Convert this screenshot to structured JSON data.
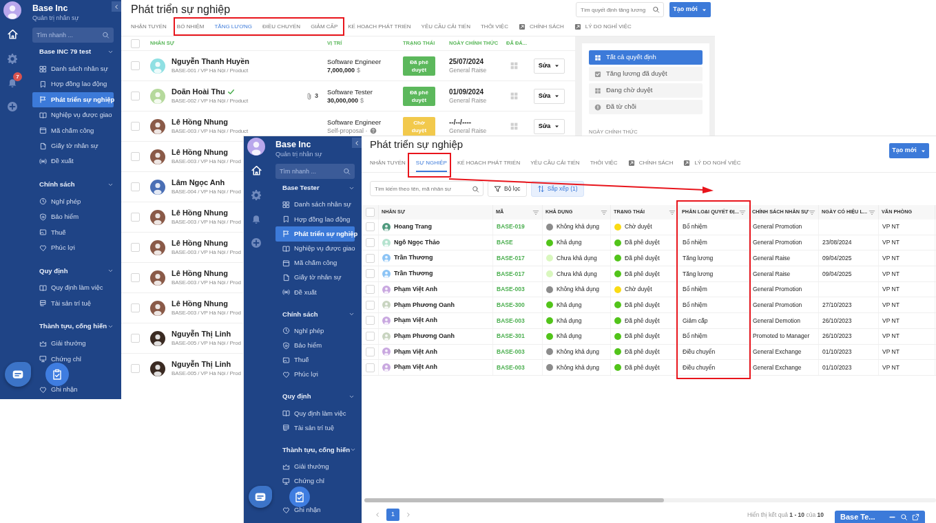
{
  "back_screen": {
    "sidebar": {
      "brand": "Base Inc",
      "subtitle": "Quản trị nhân sự",
      "search": {
        "placeholder": "Tìm nhanh ..."
      },
      "notification_count": "7",
      "groups": [
        {
          "title": "Base INC 79 test",
          "expanded": true,
          "items": [
            {
              "label": "Danh sách nhân sự",
              "selected": false
            },
            {
              "label": "Hợp đồng lao động",
              "selected": false
            },
            {
              "label": "Phát triển sự nghiệp",
              "selected": true
            },
            {
              "label": "Nghiệp vụ được giao",
              "selected": false
            },
            {
              "label": "Mã chấm công",
              "selected": false
            },
            {
              "label": "Giấy tờ nhân sự",
              "selected": false
            },
            {
              "label": "Đề xuất",
              "selected": false
            }
          ]
        },
        {
          "title": "Chính sách",
          "expanded": true,
          "items": [
            {
              "label": "Nghỉ phép",
              "selected": false
            },
            {
              "label": "Bảo hiểm",
              "selected": false
            },
            {
              "label": "Thuế",
              "selected": false
            },
            {
              "label": "Phúc lợi",
              "selected": false
            }
          ]
        },
        {
          "title": "Quy định",
          "expanded": true,
          "items": [
            {
              "label": "Quy định làm việc",
              "selected": false
            },
            {
              "label": "Tài sản trí tuệ",
              "selected": false
            }
          ]
        },
        {
          "title": "Thành tựu, cống hiến",
          "expanded": true,
          "items": [
            {
              "label": "Giải thưởng",
              "selected": false
            },
            {
              "label": "Chứng chỉ",
              "selected": false
            },
            {
              "label": "Ghi nhận",
              "selected": false
            }
          ]
        }
      ]
    },
    "title": "Phát triển sự nghiệp",
    "search": {
      "placeholder": "Tìm quyết định tăng lương"
    },
    "create_button": "Tạo mới",
    "tabs": [
      {
        "label": "NHẬN TUYỂN",
        "selected": false,
        "kind": "page"
      },
      {
        "label": "BỔ NHIỆM",
        "selected": false,
        "kind": "page"
      },
      {
        "label": "TĂNG LƯƠNG",
        "selected": true,
        "kind": "page"
      },
      {
        "label": "ĐIỀU CHUYỂN",
        "selected": false,
        "kind": "page"
      },
      {
        "label": "GIẢM CẤP",
        "selected": false,
        "kind": "page"
      },
      {
        "label": "KẾ HOẠCH PHÁT TRIỂN",
        "selected": false,
        "kind": "page"
      },
      {
        "label": "YÊU CẦU CẢI TIẾN",
        "selected": false,
        "kind": "page"
      },
      {
        "label": "THÔI VIỆC",
        "selected": false,
        "kind": "page"
      },
      {
        "label": "CHÍNH SÁCH",
        "selected": false,
        "kind": "link"
      },
      {
        "label": "LÝ DO NGHỈ VIỆC",
        "selected": false,
        "kind": "link"
      }
    ],
    "table": {
      "all_checked": false,
      "columns": [
        "NHÂN SỰ",
        "VỊ TRÍ",
        "TRẠNG THÁI",
        "NGÀY CHÍNH THỨC",
        "ĐÃ ĐÁ..."
      ],
      "rows": [
        {
          "checked": false,
          "color": "#8fe0e3",
          "name": "Nguyễn Thanh Huyền",
          "sub": "BASE-001 / VP Hà Nội / Product",
          "position": "Software Engineer",
          "salary": "7,000,000",
          "currency": "$",
          "status": {
            "label": "Đã phê duyệt",
            "color": "#5cb85c"
          },
          "date": "25/07/2024",
          "date_note": "General Raise",
          "action": "Sửa"
        },
        {
          "checked": false,
          "color": "#b5d99c",
          "name": "Doãn Hoài Thu",
          "verified": true,
          "attachments": "3",
          "sub": "BASE-002 / VP Hà Nội / Product",
          "position": "Software Tester",
          "salary": "30,000,000",
          "currency": "$",
          "status": {
            "label": "Đã phê duyệt",
            "color": "#5cb85c"
          },
          "date": "01/09/2024",
          "date_note": "General Raise",
          "action": "Sửa"
        },
        {
          "checked": false,
          "color": "#8a5a48",
          "name": "Lê Hồng Nhung",
          "sub": "BASE-003 / VP Hà Nội / Product",
          "position": "Software Engineer",
          "note": "Self-proposal ·",
          "status": {
            "label": "Chờ duyệt",
            "color": "#f2c94c"
          },
          "date": "--/--/----",
          "date_note": "General Raise",
          "action": "Sửa"
        },
        {
          "checked": false,
          "color": "#8a5a48",
          "name": "Lê Hồng Nhung",
          "sub": "BASE-003 / VP Hà Nội / Prod"
        },
        {
          "checked": false,
          "color": "#4a6fb5",
          "name": "Lâm Ngọc Anh",
          "sub": "BASE-004 / VP Hà Nội / Prod"
        },
        {
          "checked": false,
          "color": "#8a5a48",
          "name": "Lê Hồng Nhung",
          "sub": "BASE-003 / VP Hà Nội / Prod"
        },
        {
          "checked": false,
          "color": "#8a5a48",
          "name": "Lê Hồng Nhung",
          "sub": "BASE-003 / VP Hà Nội / Prod"
        },
        {
          "checked": false,
          "color": "#8a5a48",
          "name": "Lê Hồng Nhung",
          "sub": "BASE-003 / VP Hà Nội / Prod"
        },
        {
          "checked": false,
          "color": "#8a5a48",
          "name": "Lê Hồng Nhung",
          "sub": "BASE-003 / VP Hà Nội / Prod"
        },
        {
          "checked": false,
          "color": "#3a2a22",
          "name": "Nguyễn Thị Linh",
          "sub": "BASE-005 / VP Hà Nội / Prod"
        },
        {
          "checked": false,
          "color": "#3a2a22",
          "name": "Nguyễn Thị Linh",
          "sub": "BASE-005 / VP Hà Nội / Prod"
        }
      ]
    },
    "filter_panel": {
      "items": [
        {
          "label": "Tất cả quyết định",
          "selected": true
        },
        {
          "label": "Tăng lương đã duyệt",
          "selected": false
        },
        {
          "label": "Đang chờ duyệt",
          "selected": false
        },
        {
          "label": "Đã từ chối",
          "selected": false
        }
      ],
      "section_label": "NGÀY CHÍNH THỨC"
    }
  },
  "front_screen": {
    "sidebar": {
      "brand": "Base Inc",
      "subtitle": "Quản trị nhân sự",
      "search": {
        "placeholder": "Tìm nhanh ..."
      },
      "groups": [
        {
          "title": "Base Tester",
          "expanded": true,
          "items": [
            {
              "label": "Danh sách nhân sự",
              "selected": false
            },
            {
              "label": "Hợp đồng lao động",
              "selected": false
            },
            {
              "label": "Phát triển sự nghiệp",
              "selected": true
            },
            {
              "label": "Nghiệp vụ được giao",
              "selected": false
            },
            {
              "label": "Mã chấm công",
              "selected": false
            },
            {
              "label": "Giấy tờ nhân sự",
              "selected": false
            },
            {
              "label": "Đề xuất",
              "selected": false
            }
          ]
        },
        {
          "title": "Chính sách",
          "expanded": true,
          "items": [
            {
              "label": "Nghỉ phép",
              "selected": false
            },
            {
              "label": "Bảo hiểm",
              "selected": false
            },
            {
              "label": "Thuế",
              "selected": false
            },
            {
              "label": "Phúc lợi",
              "selected": false
            }
          ]
        },
        {
          "title": "Quy định",
          "expanded": true,
          "items": [
            {
              "label": "Quy định làm việc",
              "selected": false
            },
            {
              "label": "Tài sản trí tuệ",
              "selected": false
            }
          ]
        },
        {
          "title": "Thành tựu, cống hiến",
          "expanded": true,
          "items": [
            {
              "label": "Giải thưởng",
              "selected": false
            },
            {
              "label": "Chứng chỉ",
              "selected": false
            },
            {
              "label": "Ghi nhận",
              "selected": false
            }
          ]
        }
      ]
    },
    "title": "Phát triển sự nghiệp",
    "create_button": "Tạo mới",
    "tabs": [
      {
        "label": "NHẬN TUYỂN",
        "selected": false,
        "kind": "page"
      },
      {
        "label": "SỰ NGHIỆP",
        "selected": true,
        "kind": "page"
      },
      {
        "label": "KẾ HOẠCH PHÁT TRIỂN",
        "selected": false,
        "kind": "page"
      },
      {
        "label": "YÊU CẦU CẢI TIẾN",
        "selected": false,
        "kind": "page"
      },
      {
        "label": "THÔI VIỆC",
        "selected": false,
        "kind": "page"
      },
      {
        "label": "CHÍNH SÁCH",
        "selected": false,
        "kind": "link"
      },
      {
        "label": "LÝ DO NGHỈ VIỆC",
        "selected": false,
        "kind": "link"
      }
    ],
    "search": {
      "placeholder": "Tìm kiếm theo tên, mã nhân sự"
    },
    "filter_button": "Bộ lọc",
    "sort_button": "Sắp xếp (1)",
    "table": {
      "all_checked": false,
      "columns": [
        {
          "label": "NHÂN SỰ",
          "filterable": false
        },
        {
          "label": "MÃ",
          "filterable": true
        },
        {
          "label": "KHẢ DỤNG",
          "filterable": true
        },
        {
          "label": "TRẠNG THÁI",
          "filterable": true
        },
        {
          "label": "PHÂN LOẠI QUYẾT ĐỊ...",
          "filterable": true
        },
        {
          "label": "CHÍNH SÁCH NHÂN SỰ",
          "filterable": true
        },
        {
          "label": "NGÀY CÓ HIỆU L...",
          "filterable": true
        },
        {
          "label": "VĂN PHÒNG",
          "filterable": false
        }
      ],
      "rows": [
        {
          "checked": false,
          "color": "#4f9a7e",
          "name": "Hoang Trang",
          "code": "BASE-019",
          "availability": {
            "label": "Không khả dụng",
            "color": "#8c8c8c"
          },
          "status": {
            "label": "Chờ duyệt",
            "color": "#fadb14"
          },
          "decision_type": "Bổ nhiệm",
          "policy": "General Promotion",
          "office": "VP NT"
        },
        {
          "checked": false,
          "color": "#b5e3cf",
          "name": "Ngô Ngọc Thảo",
          "code": "BASE",
          "availability": {
            "label": "Khả dụng",
            "color": "#52c41a"
          },
          "status": {
            "label": "Đã phê duyệt",
            "color": "#52c41a"
          },
          "decision_type": "Bổ nhiệm",
          "policy": "General Promotion",
          "effective_date": "23/08/2024",
          "office": "VP NT"
        },
        {
          "checked": false,
          "color": "#8cc4f5",
          "name": "Trần Thương",
          "code": "BASE-017",
          "availability": {
            "label": "Chưa khả dụng",
            "color": "#d9f7be"
          },
          "status": {
            "label": "Đã phê duyệt",
            "color": "#52c41a"
          },
          "decision_type": "Tăng lương",
          "policy": "General Raise",
          "effective_date": "09/04/2025",
          "office": "VP NT"
        },
        {
          "checked": false,
          "color": "#8cc4f5",
          "name": "Trần Thương",
          "code": "BASE-017",
          "availability": {
            "label": "Chưa khả dụng",
            "color": "#d9f7be"
          },
          "status": {
            "label": "Đã phê duyệt",
            "color": "#52c41a"
          },
          "decision_type": "Tăng lương",
          "policy": "General Raise",
          "effective_date": "09/04/2025",
          "office": "VP NT"
        },
        {
          "checked": false,
          "color": "#c9a8e0",
          "name": "Phạm Việt Anh",
          "code": "BASE-003",
          "availability": {
            "label": "Không khả dụng",
            "color": "#8c8c8c"
          },
          "status": {
            "label": "Chờ duyệt",
            "color": "#fadb14"
          },
          "decision_type": "Bổ nhiệm",
          "policy": "General Promotion",
          "office": "VP NT"
        },
        {
          "checked": false,
          "color": "#c8d4c0",
          "name": "Phạm Phương Oanh",
          "code": "BASE-300",
          "availability": {
            "label": "Khả dụng",
            "color": "#52c41a"
          },
          "status": {
            "label": "Đã phê duyệt",
            "color": "#52c41a"
          },
          "decision_type": "Bổ nhiệm",
          "policy": "General Promotion",
          "effective_date": "27/10/2023",
          "office": "VP NT"
        },
        {
          "checked": false,
          "color": "#c9a8e0",
          "name": "Phạm Việt Anh",
          "code": "BASE-003",
          "availability": {
            "label": "Khả dụng",
            "color": "#52c41a"
          },
          "status": {
            "label": "Đã phê duyệt",
            "color": "#52c41a"
          },
          "decision_type": "Giảm cấp",
          "policy": "General Demotion",
          "effective_date": "26/10/2023",
          "office": "VP NT"
        },
        {
          "checked": false,
          "color": "#c8d4c0",
          "name": "Phạm Phương Oanh",
          "code": "BASE-301",
          "availability": {
            "label": "Khả dụng",
            "color": "#52c41a"
          },
          "status": {
            "label": "Đã phê duyệt",
            "color": "#52c41a"
          },
          "decision_type": "Bổ nhiệm",
          "policy": "Promoted to Manager",
          "effective_date": "26/10/2023",
          "office": "VP NT"
        },
        {
          "checked": false,
          "color": "#c9a8e0",
          "name": "Phạm Việt Anh",
          "code": "BASE-003",
          "availability": {
            "label": "Không khả dụng",
            "color": "#8c8c8c"
          },
          "status": {
            "label": "Đã phê duyệt",
            "color": "#52c41a"
          },
          "decision_type": "Điều chuyển",
          "policy": "General Exchange",
          "effective_date": "01/10/2023",
          "office": "VP NT"
        },
        {
          "checked": false,
          "color": "#c9a8e0",
          "name": "Phạm Việt Anh",
          "code": "BASE-003",
          "availability": {
            "label": "Không khả dụng",
            "color": "#8c8c8c"
          },
          "status": {
            "label": "Đã phê duyệt",
            "color": "#52c41a"
          },
          "decision_type": "Điều chuyển",
          "policy": "General Exchange",
          "effective_date": "01/10/2023",
          "office": "VP NT"
        }
      ]
    },
    "pagination": {
      "pages": [
        {
          "label": "1",
          "selected": true
        }
      ],
      "summary": "Hiển thị kết quả **1 - 10** của **10**"
    },
    "chat_widget": {
      "title": "Base Te..."
    }
  },
  "annotations": [
    {
      "kind": "frame"
    },
    {
      "kind": "frame"
    },
    {
      "kind": "arrow"
    },
    {
      "kind": "frame"
    }
  ]
}
